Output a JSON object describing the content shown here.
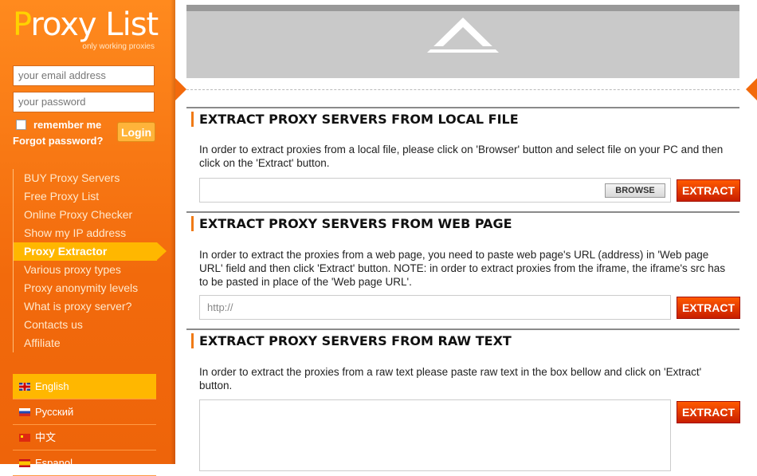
{
  "sidebar": {
    "logo_first": "P",
    "logo_rest": "roxy List",
    "tagline": "only working proxies",
    "email_placeholder": "your email address",
    "password_placeholder": "your password",
    "remember_label": "remember me",
    "forgot_label": "Forgot password?",
    "login_label": "Login",
    "nav": [
      {
        "label": "BUY Proxy Servers"
      },
      {
        "label": "Free Proxy List"
      },
      {
        "label": "Online Proxy Checker"
      },
      {
        "label": "Show my IP address"
      },
      {
        "label": "Proxy Extractor",
        "active": true
      },
      {
        "label": "Various proxy types"
      },
      {
        "label": "Proxy anonymity levels"
      },
      {
        "label": "What is proxy server?"
      },
      {
        "label": "Contacts us"
      },
      {
        "label": "Affiliate"
      }
    ],
    "languages": [
      {
        "label": "English",
        "flag": "uk-flag-icon",
        "active": true
      },
      {
        "label": "Русский",
        "flag": "ru-flag-icon"
      },
      {
        "label": "中文",
        "flag": "cn-flag-icon"
      },
      {
        "label": "Espanol",
        "flag": "es-flag-icon"
      }
    ]
  },
  "sections": {
    "local_file": {
      "title": "EXTRACT PROXY SERVERS FROM LOCAL FILE",
      "text": "In order to extract proxies from a local file, please click on 'Browser' button and select file on your PC and then click on the 'Extract' button.",
      "browse_label": "BROWSE",
      "extract_label": "EXTRACT"
    },
    "web_page": {
      "title": "EXTRACT PROXY SERVERS FROM WEB PAGE",
      "text": "In order to extract the proxies from a web page, you need to paste web page's URL (address) in 'Web page URL' field and then click 'Extract' button. NOTE: in order to extract proxies from the iframe, the iframe's src has to be pasted in place of the 'Web page URL'.",
      "url_placeholder": "http://",
      "extract_label": "EXTRACT"
    },
    "raw_text": {
      "title": "EXTRACT PROXY SERVERS FROM RAW TEXT",
      "text": "In order to extract the proxies from a raw text please paste raw text in the box bellow and click on 'Extract' button.",
      "extract_label": "EXTRACT"
    }
  },
  "colors": {
    "sidebar_orange": "#f26a0c",
    "active_nav": "#ffb700",
    "extract_red": "#c81e00",
    "accent_bar": "#f07a16"
  }
}
